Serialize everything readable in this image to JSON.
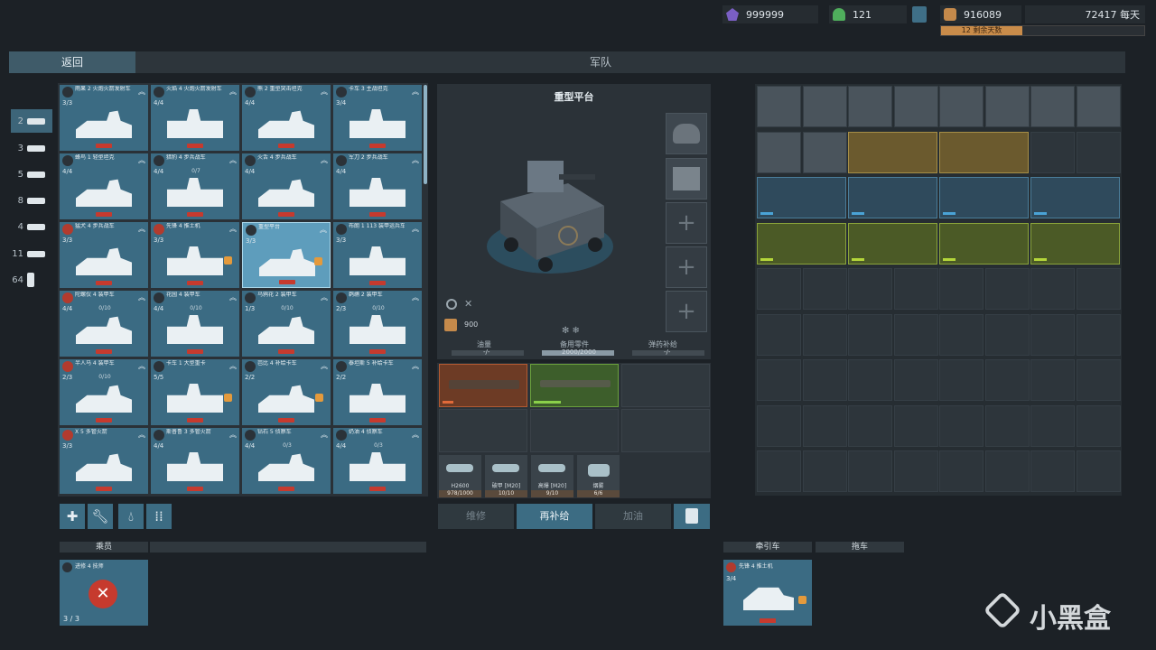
{
  "resources": {
    "gems": "999999",
    "crew": "121",
    "materials": "916089",
    "income": "72417 每天",
    "progress_label": "12 剩余天数",
    "progress": 0.4
  },
  "header": {
    "back_label": "返回",
    "title": "军队"
  },
  "categories": [
    {
      "count": "2"
    },
    {
      "count": "3"
    },
    {
      "count": "5"
    },
    {
      "count": "8"
    },
    {
      "count": "4"
    },
    {
      "count": "11"
    },
    {
      "count": "64"
    }
  ],
  "vehicles": [
    {
      "name": "雨果 2 火炮火箭发射车",
      "count": "3/3",
      "sub": "",
      "rank": "︽"
    },
    {
      "name": "火焰 4 火炮火箭发射车",
      "count": "4/4",
      "sub": "",
      "rank": "︽"
    },
    {
      "name": "熊 2 重型突击坦克",
      "count": "4/4",
      "sub": "",
      "rank": "︽"
    },
    {
      "name": "卡车 3 主战坦克",
      "count": "3/4",
      "sub": "",
      "rank": "︽"
    },
    {
      "name": "蜂鸟 1 轻型坦克",
      "count": "4/4",
      "sub": "",
      "rank": "︽"
    },
    {
      "name": "猎豹 4 步兵战车",
      "count": "4/4",
      "sub": "0/7",
      "rank": "︽"
    },
    {
      "name": "火舌 4 步兵战车",
      "count": "4/4",
      "sub": "",
      "rank": "︽"
    },
    {
      "name": "军刀 2 步兵战车",
      "count": "4/4",
      "sub": "",
      "rank": "︽"
    },
    {
      "name": "猛犬 4 步兵战车",
      "count": "3/3",
      "sub": "",
      "rank": "︽"
    },
    {
      "name": "先锋 4 推土机",
      "count": "3/3",
      "sub": "",
      "rank": "︽"
    },
    {
      "name": "重型平台",
      "count": "3/3",
      "sub": "",
      "rank": "︽"
    },
    {
      "name": "布朗 1 113 装甲运兵车",
      "count": "3/3",
      "sub": "",
      "rank": "︽"
    },
    {
      "name": "陀螺仪 4 装甲车",
      "count": "4/4",
      "sub": "0/10",
      "rank": "︽"
    },
    {
      "name": "花园 4 装甲车",
      "count": "4/4",
      "sub": "0/10",
      "rank": "︽"
    },
    {
      "name": "乌鸦花 2 装甲车",
      "count": "1/3",
      "sub": "0/10",
      "rank": "︽"
    },
    {
      "name": "鹈鹕 2 装甲车",
      "count": "2/3",
      "sub": "0/10",
      "rank": "︽"
    },
    {
      "name": "半人马 4 装甲车",
      "count": "2/3",
      "sub": "0/10",
      "rank": "︽"
    },
    {
      "name": "卡车 1 大型重卡",
      "count": "5/5",
      "sub": "",
      "rank": "︽"
    },
    {
      "name": "芭比 4 补给卡车",
      "count": "2/2",
      "sub": "",
      "rank": "︽"
    },
    {
      "name": "泰坦斯 5 补给卡车",
      "count": "2/2",
      "sub": "",
      "rank": "︽"
    },
    {
      "name": "X 5 多管火箭",
      "count": "3/3",
      "sub": "",
      "rank": "︽"
    },
    {
      "name": "斯普鲁 3 多管火箭",
      "count": "4/4",
      "sub": "",
      "rank": "︽"
    },
    {
      "name": "钻石 5 侦察车",
      "count": "4/4",
      "sub": "0/3",
      "rank": "︽"
    },
    {
      "name": "奶油 4 侦察车",
      "count": "4/4",
      "sub": "0/3",
      "rank": "︽"
    }
  ],
  "detail": {
    "title": "重型平台",
    "cost": "900",
    "stats": [
      {
        "label": "油量",
        "value": "-/-"
      },
      {
        "label": "备用零件",
        "value": "2000/2000"
      },
      {
        "label": "弹药补给",
        "value": "-/-"
      }
    ],
    "ammo": [
      {
        "label": "H2600",
        "qty": "978/1000"
      },
      {
        "label": "破甲 [M20]",
        "qty": "10/10"
      },
      {
        "label": "高爆 [M20]",
        "qty": "9/10"
      },
      {
        "label": "烟雾",
        "qty": "6/6"
      }
    ],
    "actions": {
      "repair": "维修",
      "resupply": "再补给",
      "refuel": "加油"
    }
  },
  "bottom": {
    "crew_title": "乘员",
    "crew_name": "进修 4 技师",
    "crew_count": "3 / 3",
    "tow_title": "牵引车",
    "trailer_title": "拖车",
    "tow_name": "先锋 4 推土机",
    "tow_count": "3/4"
  },
  "watermark": "小黑盒",
  "colors": {
    "card": "#3b6b83",
    "card_selected": "#5e9dbc",
    "accent": "#3c6c83",
    "progress": "#c98c4a"
  }
}
